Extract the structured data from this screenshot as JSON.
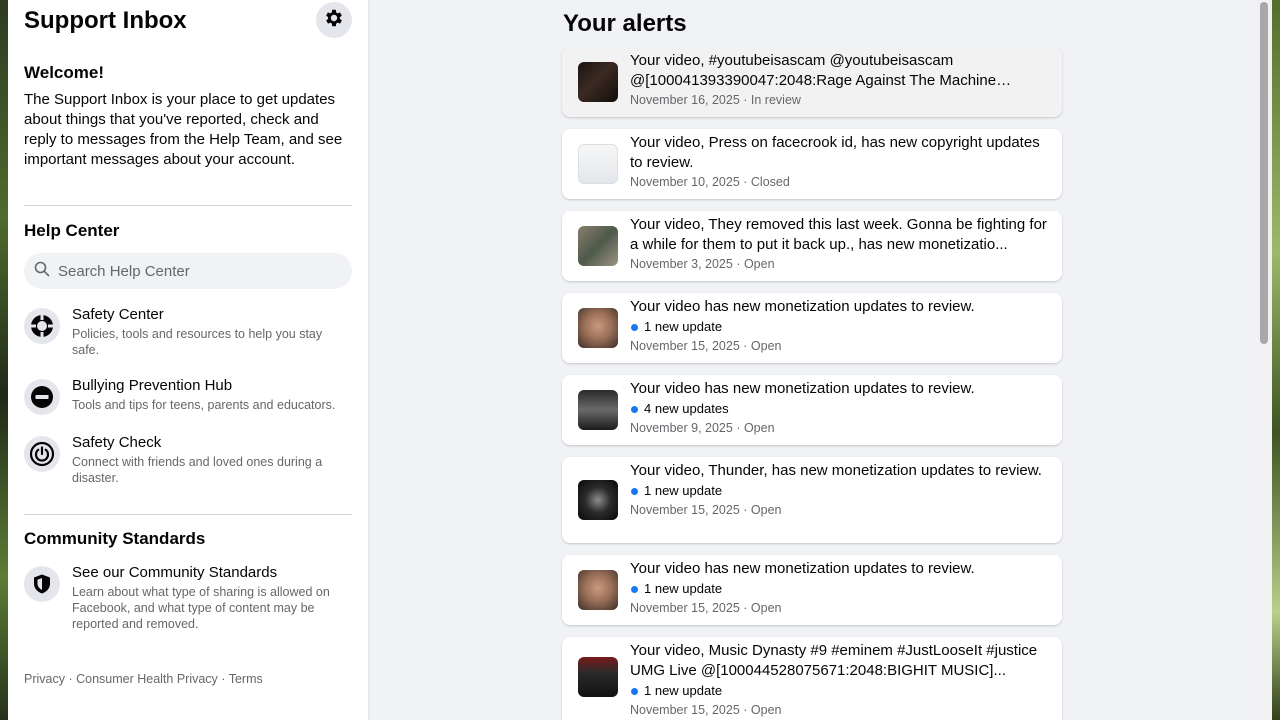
{
  "sidebar": {
    "title": "Support Inbox",
    "welcome_title": "Welcome!",
    "welcome_text": "The Support Inbox is your place to get updates about things that you've reported, check and reply to messages from the Help Team, and see important messages about your account.",
    "help_center": {
      "title": "Help Center",
      "search_placeholder": "Search Help Center",
      "items": [
        {
          "title": "Safety Center",
          "desc": "Policies, tools and resources to help you stay safe.",
          "icon": "lifebuoy-icon"
        },
        {
          "title": "Bullying Prevention Hub",
          "desc": "Tools and tips for teens, parents and educators.",
          "icon": "no-entry-icon"
        },
        {
          "title": "Safety Check",
          "desc": "Connect with friends and loved ones during a disaster.",
          "icon": "power-icon"
        }
      ]
    },
    "community": {
      "title": "Community Standards",
      "item_title": "See our Community Standards",
      "item_desc": "Learn about what type of sharing is allowed on Facebook, and what type of content may be reported and removed.",
      "icon": "shield-icon"
    },
    "footer": {
      "line1": [
        "Privacy",
        "Consumer Health Privacy",
        "Terms"
      ],
      "separator": " · "
    }
  },
  "main": {
    "title": "Your alerts",
    "alerts": [
      {
        "title": "Your video, #youtubeisascam @youtubeisascam @[100041393390047:2048:Rage Against The Machine Brasil...",
        "update": "",
        "date": "November 16, 2025",
        "status": "In review"
      },
      {
        "title": "Your video, Press on facecrook id, has new copyright updates to review.",
        "update": "",
        "date": "November 10, 2025",
        "status": "Closed"
      },
      {
        "title": "Your video, They removed this last week. Gonna be fighting for a while for them to put it back up., has new monetizatio...",
        "update": "",
        "date": "November 3, 2025",
        "status": "Open"
      },
      {
        "title": "Your video has new monetization updates to review.",
        "update": "1 new update",
        "date": "November 15, 2025",
        "status": "Open"
      },
      {
        "title": "Your video has new monetization updates to review.",
        "update": "4 new updates",
        "date": "November 9, 2025",
        "status": "Open"
      },
      {
        "title": "Your video, Thunder, has new monetization updates to review.",
        "update": "1 new update",
        "date": "November 15, 2025",
        "status": "Open"
      },
      {
        "title": "Your video has new monetization updates to review.",
        "update": "1 new update",
        "date": "November 15, 2025",
        "status": "Open"
      },
      {
        "title": "Your video, Music Dynasty #9 #eminem #JustLooseIt #justice UMG Live @[100044528075671:2048:BIGHIT MUSIC]...",
        "update": "1 new update",
        "date": "November 15, 2025",
        "status": "Open"
      }
    ],
    "meta_separator": " · "
  },
  "colors": {
    "accent": "#1877f2",
    "background": "#f0f2f5",
    "card": "#ffffff",
    "secondary_text": "#65676b"
  }
}
